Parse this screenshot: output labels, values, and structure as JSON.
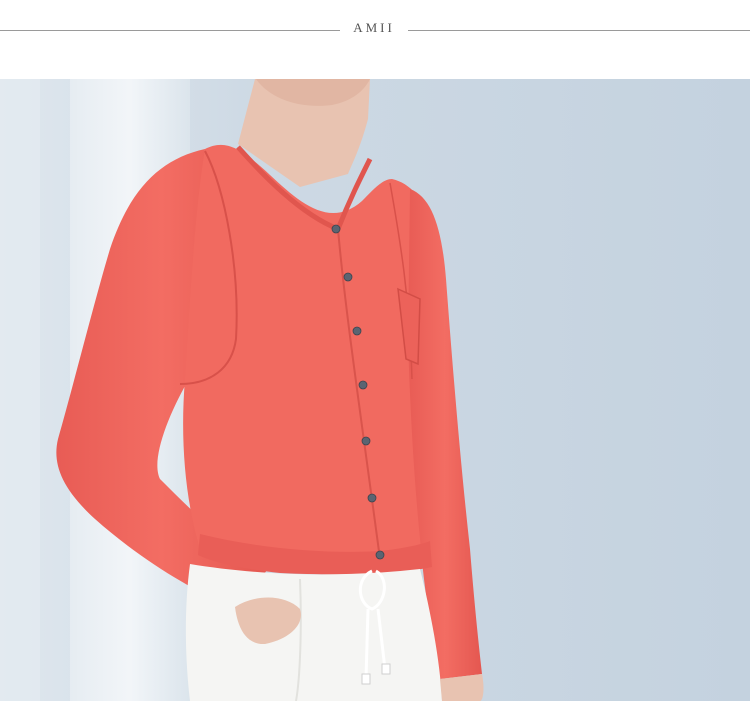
{
  "header": {
    "brand": "AMII"
  },
  "photo": {
    "subject": "model-wearing-coral-knit-cardigan",
    "colors": {
      "background": "#c9d6e2",
      "curtain": "#eef3f7",
      "cardigan": "#f0655c",
      "cardigan_shadow": "#d9544c",
      "skin": "#e9c7b6",
      "pants": "#f6f6f4",
      "button": "#5a6472"
    }
  }
}
